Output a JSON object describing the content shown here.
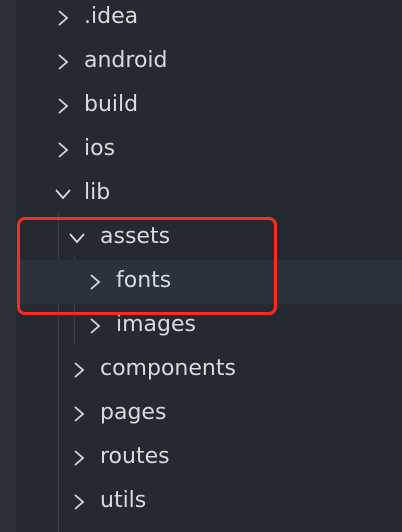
{
  "explorer": {
    "items": [
      {
        "label": ".idea",
        "expanded": false
      },
      {
        "label": "android",
        "expanded": false
      },
      {
        "label": "build",
        "expanded": false
      },
      {
        "label": "ios",
        "expanded": false
      },
      {
        "label": "lib",
        "expanded": true
      },
      {
        "label": "assets",
        "expanded": true
      },
      {
        "label": "fonts",
        "expanded": false,
        "selected": true
      },
      {
        "label": "images",
        "expanded": false
      },
      {
        "label": "components",
        "expanded": false
      },
      {
        "label": "pages",
        "expanded": false
      },
      {
        "label": "routes",
        "expanded": false
      },
      {
        "label": "utils",
        "expanded": false
      }
    ]
  },
  "colors": {
    "highlight": "#ff2a1f",
    "background": "#252a31",
    "text": "#d7dae0"
  }
}
